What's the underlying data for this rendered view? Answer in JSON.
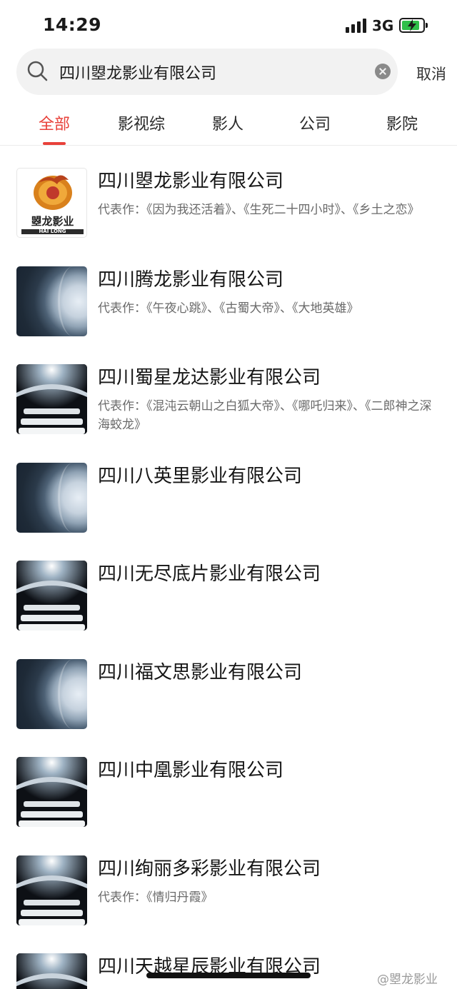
{
  "status_bar": {
    "time": "14:29",
    "network": "3G",
    "battery_color": "#2fbf4a",
    "battery_level": 0.85
  },
  "search": {
    "query": "四川曌龙影业有限公司",
    "cancel_label": "取消"
  },
  "tabs": [
    {
      "label": "全部",
      "active": true
    },
    {
      "label": "影视综"
    },
    {
      "label": "影人"
    },
    {
      "label": "公司"
    },
    {
      "label": "影院"
    }
  ],
  "accent_color": "#e8413a",
  "results": [
    {
      "title": "四川曌龙影业有限公司",
      "subtitle": "代表作：《因为我还活着》、《生死二十四小时》、《乡土之恋》",
      "thumb": "hailong-logo",
      "logo_text": "曌龙影业",
      "logo_sub": "HAI LONG"
    },
    {
      "title": "四川腾龙影业有限公司",
      "subtitle": "代表作：《午夜心跳》、《古蜀大帝》、《大地英雄》",
      "thumb": "camera-lens-icon"
    },
    {
      "title": "四川蜀星龙达影业有限公司",
      "subtitle": "代表作：《混沌云朝山之白狐大帝》、《哪吒归来》、《二郎神之深海蛟龙》",
      "thumb": "cinema-seats-icon"
    },
    {
      "title": "四川八英里影业有限公司",
      "subtitle": "",
      "thumb": "camera-lens-icon"
    },
    {
      "title": "四川无尽底片影业有限公司",
      "subtitle": "",
      "thumb": "cinema-seats-icon"
    },
    {
      "title": "四川福文思影业有限公司",
      "subtitle": "",
      "thumb": "camera-lens-icon"
    },
    {
      "title": "四川中凰影业有限公司",
      "subtitle": "",
      "thumb": "cinema-seats-icon"
    },
    {
      "title": "四川绚丽多彩影业有限公司",
      "subtitle": "代表作：《情归丹霞》",
      "thumb": "cinema-seats-icon"
    },
    {
      "title": "四川天越星辰影业有限公司",
      "subtitle": "",
      "thumb": "cinema-seats-icon"
    }
  ],
  "watermark": "@曌龙影业"
}
